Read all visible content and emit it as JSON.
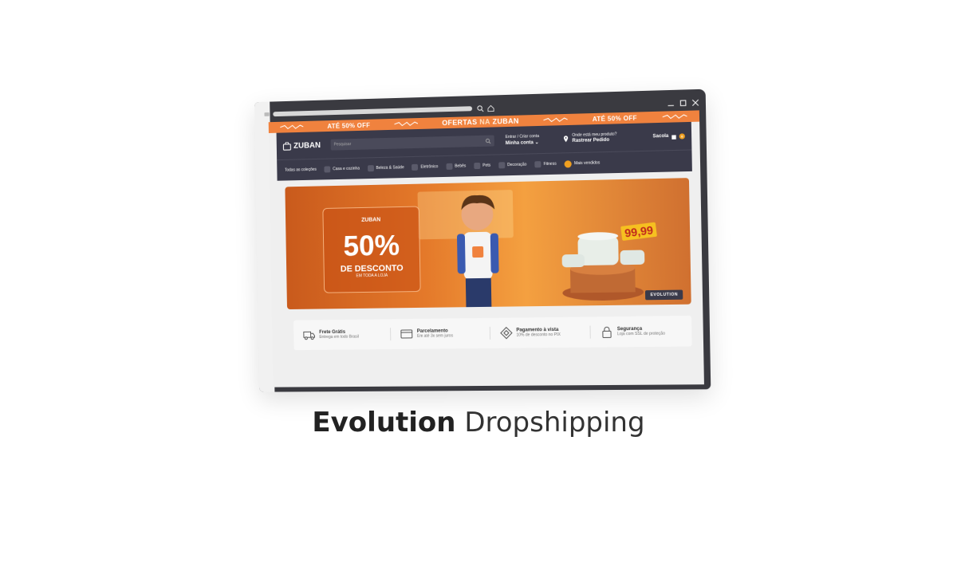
{
  "promo_bar": {
    "left": "ATÉ 50% OFF",
    "center_prefix": "OFERTAS",
    "center_mid": "NA",
    "center_brand": "ZUBAN",
    "right": "ATÉ 50% OFF"
  },
  "header": {
    "logo": "ZUBAN",
    "search_placeholder": "Pesquisar",
    "account_line1": "Entrar / Criar conta",
    "account_line2": "Minha conta",
    "track_line1": "Onde está meu produto?",
    "track_line2": "Rastrear Pedido",
    "bag_label": "Sacola",
    "bag_count": "0"
  },
  "nav": [
    "Todas as coleções",
    "Casa e cozinha",
    "Beleza & Saúde",
    "Eletrônico",
    "Bebês",
    "Pets",
    "Decoração",
    "Fitness",
    "Mais vendidos"
  ],
  "banner": {
    "logo": "ZUBAN",
    "big": "50%",
    "desc": "DE DESCONTO",
    "sub": "EM TODA A LOJA",
    "price": "99,99",
    "badge": "EVOLUTION"
  },
  "features": [
    {
      "title": "Frete Grátis",
      "sub": "Entrega em todo Brasil",
      "icon": "truck-icon"
    },
    {
      "title": "Parcelamento",
      "sub": "Em até 3x sem juros",
      "icon": "card-icon"
    },
    {
      "title": "Pagamento à vista",
      "sub": "10% de desconto no PIX",
      "icon": "pix-icon"
    },
    {
      "title": "Segurança",
      "sub": "Loja com SSL de proteção",
      "icon": "lock-icon"
    }
  ],
  "caption": {
    "bold": "Evolution",
    "light": "Dropshipping"
  },
  "colors": {
    "accent": "#f0823e",
    "dark": "#3a3a4a"
  }
}
